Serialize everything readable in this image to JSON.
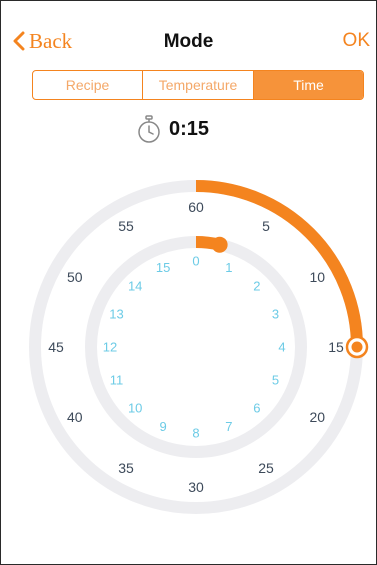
{
  "nav": {
    "back_label": "Back",
    "title": "Mode",
    "ok_label": "OK"
  },
  "segments": [
    {
      "label": "Recipe",
      "active": false
    },
    {
      "label": "Temperature",
      "active": false
    },
    {
      "label": "Time",
      "active": true
    }
  ],
  "timer": {
    "icon": "stopwatch-icon",
    "display": "0:15"
  },
  "dial": {
    "minutes_ticks": [
      "60",
      "5",
      "10",
      "15",
      "20",
      "25",
      "30",
      "35",
      "40",
      "45",
      "50",
      "55"
    ],
    "hours_ticks": [
      "0",
      "1",
      "2",
      "3",
      "4",
      "5",
      "6",
      "7",
      "8",
      "9",
      "10",
      "11",
      "12",
      "13",
      "14",
      "15"
    ],
    "minutes_value": 15,
    "hours_value": 0,
    "colors": {
      "accent": "#f4841f",
      "track": "#ededf0",
      "minute_label": "#3d4a5a",
      "hour_label": "#6ccbe6"
    }
  }
}
